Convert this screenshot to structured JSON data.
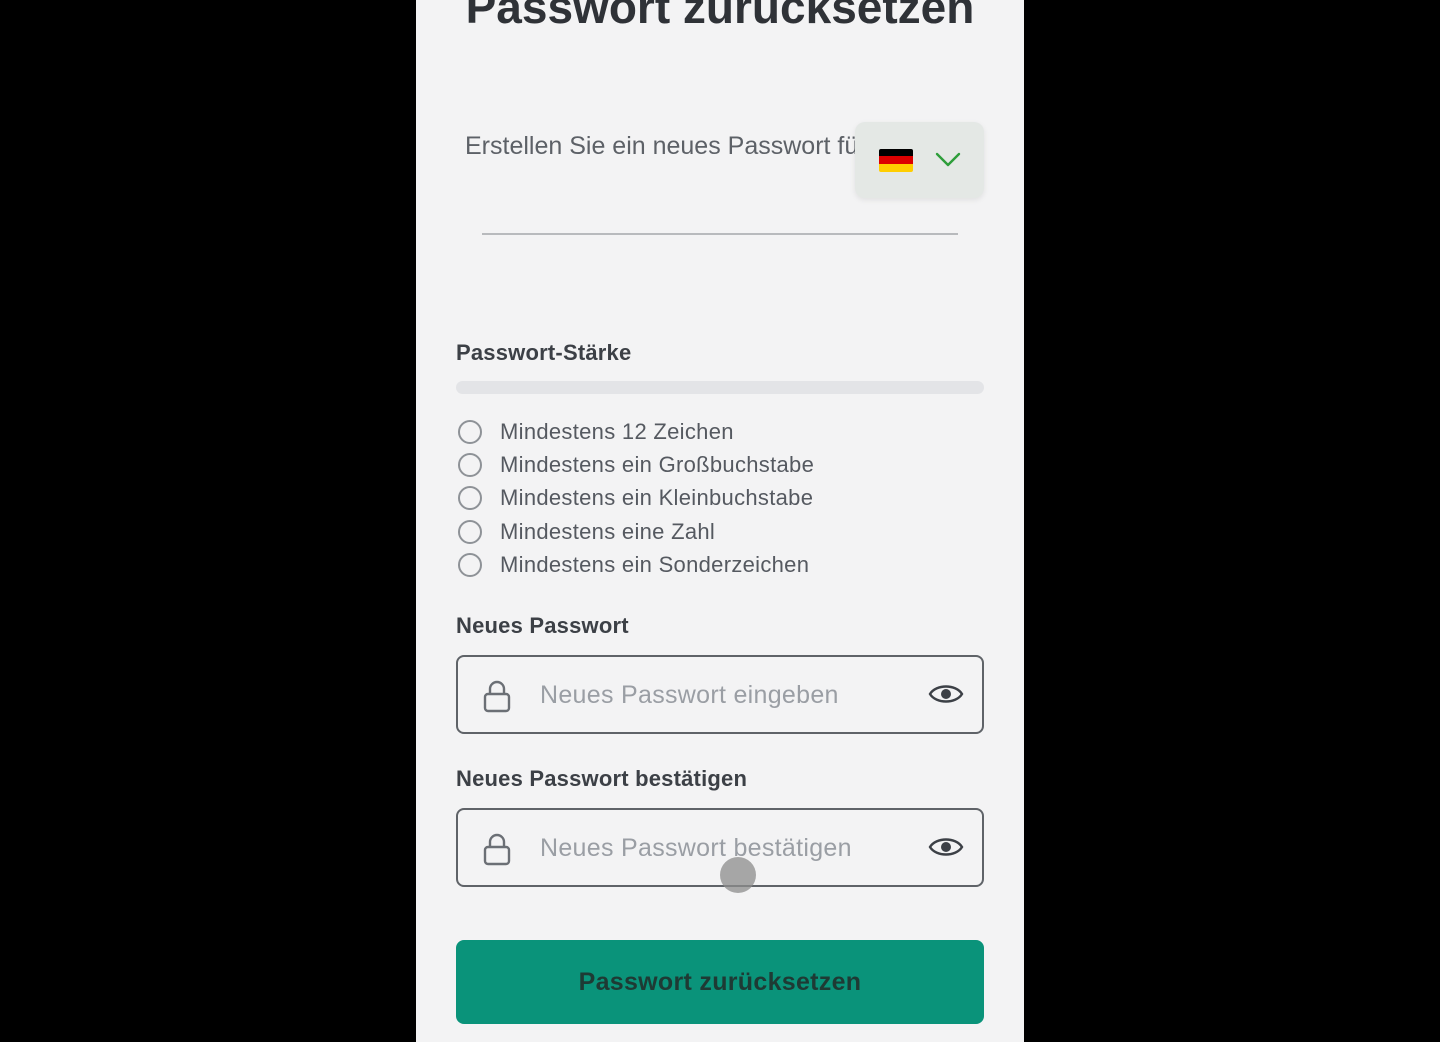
{
  "page": {
    "title": "Passwort zurücksetzen",
    "subtitle": "Erstellen Sie ein neues Passwort für Ihr Konto"
  },
  "language": {
    "flag_icon": "germany-flag-icon",
    "chevron_icon": "chevron-down-icon",
    "chevron_color": "#2e9e3a"
  },
  "strength": {
    "label": "Passwort-Stärke",
    "level": 0,
    "requirements": [
      {
        "label": "Mindestens 12 Zeichen",
        "met": false
      },
      {
        "label": "Mindestens ein Großbuchstabe",
        "met": false
      },
      {
        "label": "Mindestens ein Kleinbuchstabe",
        "met": false
      },
      {
        "label": "Mindestens eine Zahl",
        "met": false
      },
      {
        "label": "Mindestens ein Sonderzeichen",
        "met": false
      }
    ]
  },
  "new_password": {
    "label": "Neues Passwort",
    "value": "",
    "placeholder": "Neues Passwort eingeben"
  },
  "confirm_password": {
    "label": "Neues Passwort bestätigen",
    "value": "",
    "placeholder": "Neues Passwort bestätigen"
  },
  "submit": {
    "label": "Passwort zurücksetzen"
  },
  "colors": {
    "accent": "#0a937a",
    "background": "#f3f3f4"
  }
}
